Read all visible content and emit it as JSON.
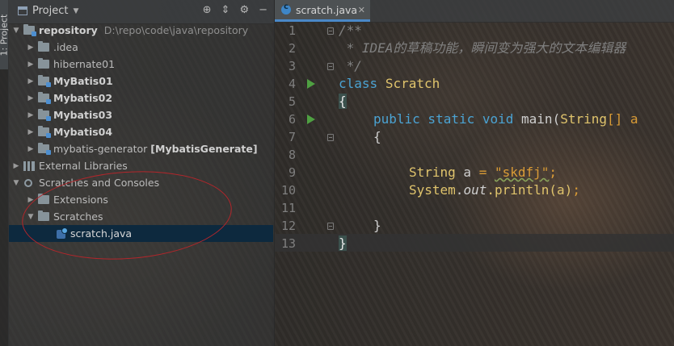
{
  "left_stripe": {
    "label": "1: Project"
  },
  "project_panel": {
    "title": "Project",
    "header_buttons": [
      "⊕",
      "⇕",
      "⚙",
      "−"
    ]
  },
  "tree": [
    {
      "label": "repository",
      "path": "D:\\repo\\code\\java\\repository"
    },
    {
      "label": ".idea"
    },
    {
      "label": "hibernate01"
    },
    {
      "label": "MyBatis01"
    },
    {
      "label": "Mybatis02"
    },
    {
      "label": "Mybatis03"
    },
    {
      "label": "Mybatis04"
    },
    {
      "label": "mybatis-generator",
      "module": "[MybatisGenerate]"
    },
    {
      "label": "External Libraries"
    },
    {
      "label": "Scratches and Consoles"
    },
    {
      "label": "Extensions"
    },
    {
      "label": "Scratches"
    },
    {
      "label": "scratch.java"
    }
  ],
  "editor": {
    "tab_label": "scratch.java",
    "line_numbers": [
      "1",
      "2",
      "3",
      "4",
      "5",
      "6",
      "7",
      "8",
      "9",
      "10",
      "11",
      "12",
      "13"
    ],
    "code": {
      "l1": "/**",
      "l2": " * IDEA的草稿功能，瞬间变为强大的文本编辑器",
      "l3": " */",
      "l4_kw": "class",
      "l4_name": "Scratch",
      "l5": "{",
      "l6_mods": "public static void",
      "l6_name": "main(",
      "l6_type": "String",
      "l6_rest": "[] a",
      "l7": "{",
      "l9_type": "String",
      "l9_var": " a ",
      "l9_eq": "=",
      "l9_str": "\"skdfj\"",
      "l9_end": ";",
      "l10_cls": "System",
      "l10_dot1": ".",
      "l10_out": "out",
      "l10_call": ".println(a)",
      "l10_end": ";",
      "l12": "}",
      "l13": "}"
    }
  }
}
